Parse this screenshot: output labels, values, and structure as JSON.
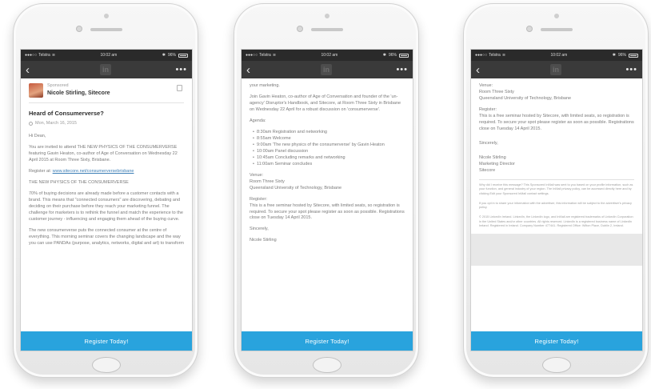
{
  "status": {
    "carrier": "Telstra",
    "time": "10:02 am",
    "battery": "96%"
  },
  "nav": {
    "back_icon": "chevron-left-icon",
    "logo": "in",
    "more_icon": "more-horizontal-icon"
  },
  "cta_label": "Register Today!",
  "screen1": {
    "sponsored": "Sponsored",
    "sponsor_name": "Nicole Stirling, Sitecore",
    "heading": "Heard of Consumerverse?",
    "date": "Mon, March 16, 2015",
    "greeting": "Hi Dean,",
    "intro": "You are invited to attend THE NEW PHYSICS OF THE CONSUMERVERSE featuring Gavin Heaton, co-author of Age of Conversation on Wednesday 22 April 2015 at Room Three Sixty, Brisbane.",
    "register_label": "Register at:",
    "register_link": "www.sitecore.net/consumerversebrisbane",
    "section_title": "THE NEW PHYSICS OF THE CONSUMERVERSE",
    "body1": "70% of buying decisions are already made before a customer contacts with a brand. This means that \"connected consumers\" are discovering, debating and deciding on their purchase before they reach your marketing funnel. The challenge for marketers is to rethink the funnel and match the experience to the customer journey - influencing and engaging them ahead of the buying curve.",
    "body2": "The new consumerverse puts the connected consumer at the centre of everything. This morning seminar covers the changing landscape and the way you can use PANDAs (purpose, analytics, networks, digital and art) to transform"
  },
  "screen2": {
    "top_line": "your marketing.",
    "join_text": "Join Gavin Heaton, co-author of Age of Conversation and founder of the 'un-agency' Disruptor's Handbook, and Sitecore, at Room Three Sixty in Brisbane on Wednesday 22 April for a robust discussion on 'consumerverse'.",
    "agenda_title": "Agenda:",
    "agenda": [
      "8:30am  Registration and networking",
      "8:55am  Welcome",
      "9:00am  'The new physics of the consumerverse' by Gavin Heaton",
      "10:00am Panel discussion",
      "10:45am Concluding remarks and networking",
      "11:00am Seminar concludes"
    ],
    "venue_title": "Venue:",
    "venue_name": "Room Three Sixty",
    "venue_location": "Queensland University of Technology, Brisbane",
    "register_title": "Register:",
    "register_text": "This is a free seminar hosted by Sitecore, with limited seats, so registration is required. To secure your spot please register as soon as possible. Registrations close on Tuesday 14 April 2015.",
    "sign_off": "Sincerely,",
    "sign_name": "Nicole Stirling"
  },
  "screen3": {
    "venue_title": "Venue:",
    "venue_name": "Room Three Sixty",
    "venue_location": "Queensland University of Technology, Brisbane",
    "register_title": "Register:",
    "register_text": "This is a free seminar hosted by Sitecore, with limited seats, so registration is required. To secure your spot please register as soon as possible. Registrations close on Tuesday 14 April 2015.",
    "sign_off": "Sincerely,",
    "sign_name": "Nicole Stirling",
    "sign_title": "Marketing Director",
    "sign_company": "Sitecore",
    "fine1": "Why did I receive this message? This Sponsored InMail was sent to you based on your profile information, such as your function, and general industry of your region. The InMail privacy policy, can be accessed directly here and by clicking Edit your Sponsored InMail contact settings.",
    "fine2": "If you opt in to share your information with the advertiser, this information will be subject to the advertiser's privacy policy.",
    "fine3": "© 2015 LinkedIn Ireland. LinkedIn, the LinkedIn logo, and InMail are registered trademarks of LinkedIn Corporation in the United States and/or other countries. All rights reserved. LinkedIn is a registered business name of LinkedIn Ireland. Registered in Ireland. Company Number 477441. Registered Office: Wilton Place, Dublin 2, Ireland."
  }
}
